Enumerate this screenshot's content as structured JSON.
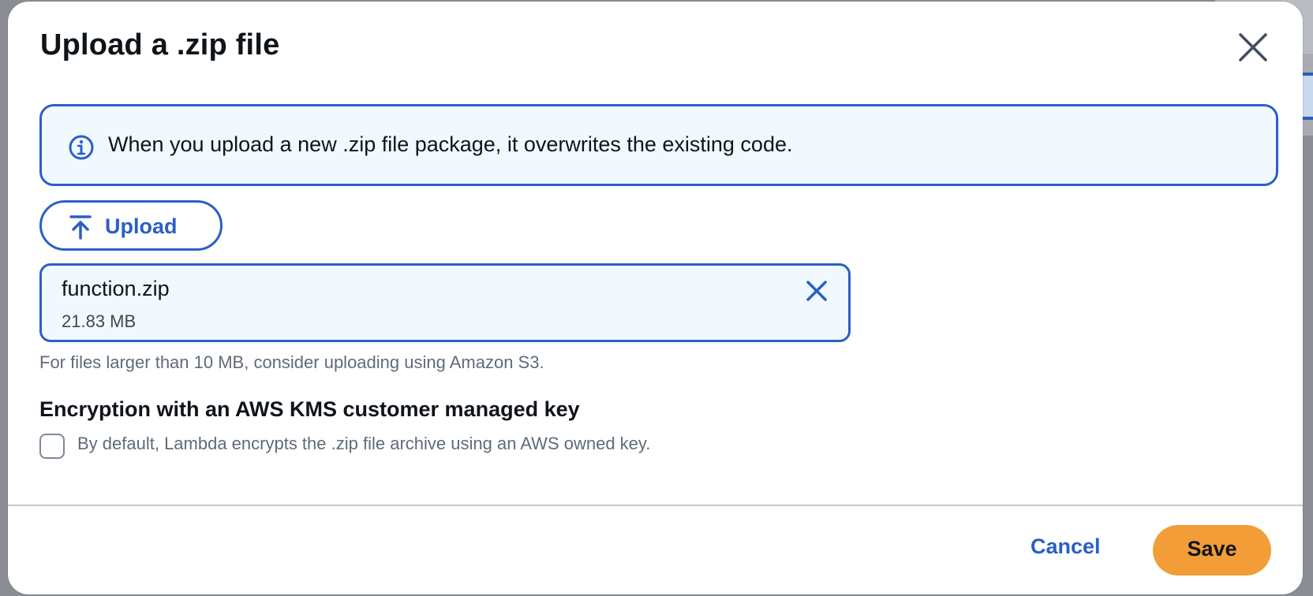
{
  "modal": {
    "title": "Upload a .zip file",
    "info_message": "When you upload a new .zip file package, it overwrites the existing code.",
    "upload_button_label": "Upload",
    "file": {
      "name": "function.zip",
      "size": "21.83 MB"
    },
    "hint": "For files larger than 10 MB, consider uploading using Amazon S3.",
    "encryption": {
      "heading": "Encryption with an AWS KMS customer managed key",
      "checkbox_label": "By default, Lambda encrypts the .zip file archive using an AWS owned key.",
      "checked": false
    },
    "cancel_label": "Cancel",
    "save_label": "Save"
  },
  "icons": {
    "close": "close-icon",
    "info": "info-icon",
    "upload": "upload-icon",
    "remove_file": "remove-file-icon"
  },
  "colors": {
    "accent": "#2a5fc8",
    "info_background": "#f1f9ff",
    "primary_button": "#f29d38",
    "text": "#0f141a",
    "secondary_text": "#5f6b7a"
  }
}
